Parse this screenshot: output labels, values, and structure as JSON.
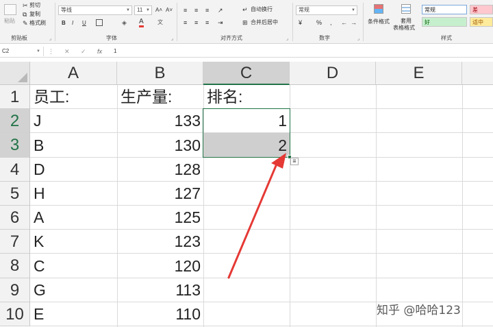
{
  "ribbon": {
    "clipboard": {
      "paste_label": "粘贴",
      "cut_label": "剪切",
      "copy_label": "复制",
      "format_painter_label": "格式刷",
      "group_label": "剪贴板"
    },
    "font": {
      "font_name": "等线",
      "font_size": "11",
      "bold": "B",
      "italic": "I",
      "underline": "U",
      "grow": "A˄",
      "shrink": "A˅",
      "font_color": "A",
      "group_label": "字体"
    },
    "alignment": {
      "wrap_label": "自动换行",
      "merge_label": "合并后居中",
      "group_label": "对齐方式"
    },
    "number": {
      "format": "常规",
      "group_label": "数字"
    },
    "styles": {
      "conditional_label": "条件格式",
      "table_format_label_1": "套用",
      "table_format_label_2": "表格格式",
      "style_normal": "常规",
      "style_bad": "差",
      "style_good": "好",
      "style_neutral": "适中",
      "group_label": "样式"
    }
  },
  "formula_bar": {
    "name_box": "C2",
    "fx_label": "fx",
    "content": "1"
  },
  "sheet": {
    "columns": [
      "A",
      "B",
      "C",
      "D",
      "E"
    ],
    "active_column": "C",
    "rows": [
      "1",
      "2",
      "3",
      "4",
      "5",
      "6",
      "7",
      "8",
      "9",
      "10"
    ],
    "data": [
      [
        "员工:",
        "生产量:",
        "排名:"
      ],
      [
        "J",
        "133",
        "1"
      ],
      [
        "B",
        "130",
        "2"
      ],
      [
        "D",
        "128",
        ""
      ],
      [
        "H",
        "127",
        ""
      ],
      [
        "A",
        "125",
        ""
      ],
      [
        "K",
        "123",
        ""
      ],
      [
        "C",
        "120",
        ""
      ],
      [
        "G",
        "113",
        ""
      ],
      [
        "E",
        "110",
        ""
      ]
    ]
  },
  "watermark": "知乎 @哈哈123",
  "colors": {
    "accent_green": "#217346",
    "arrow_red": "#e53935",
    "style_bad_bg": "#ffc7ce",
    "style_good_bg": "#c6efce",
    "style_neutral_bg": "#ffeb9c"
  }
}
